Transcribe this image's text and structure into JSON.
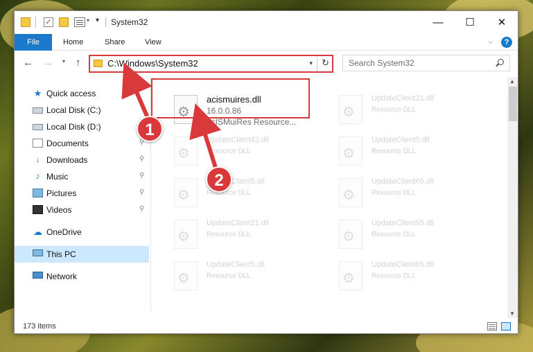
{
  "window": {
    "title": "System32",
    "controls": {
      "minimize": "—",
      "maximize": "☐",
      "close": "✕"
    }
  },
  "ribbon": {
    "tabs": [
      "File",
      "Home",
      "Share",
      "View"
    ],
    "expand_icon": "chevron-down-icon",
    "help_icon": "help-icon",
    "help_glyph": "?"
  },
  "quick_access_toolbar": {
    "icons": [
      "folder-icon",
      "properties-icon",
      "new-folder-icon",
      "view-icon",
      "dropdown-icon"
    ],
    "props_glyph": "✓",
    "drop_glyph": "▾",
    "arrow_glyph": "▾"
  },
  "navigation": {
    "back_glyph": "←",
    "forward_glyph": "→",
    "recent_glyph": "▾",
    "up_glyph": "↑",
    "address": "C:\\Windows\\System32",
    "address_drop_glyph": "▾",
    "refresh_glyph": "↻",
    "search_placeholder": "Search System32"
  },
  "sidebar": {
    "items": [
      {
        "label": "Quick access",
        "icon": "star-icon",
        "glyph": "★",
        "pinned": false
      },
      {
        "label": "Local Disk (C:)",
        "icon": "disk-icon",
        "glyph": "",
        "pinned": false
      },
      {
        "label": "Local Disk (D:)",
        "icon": "disk-icon",
        "glyph": "",
        "pinned": false
      },
      {
        "label": "Documents",
        "icon": "documents-icon",
        "glyph": "",
        "pinned": true
      },
      {
        "label": "Downloads",
        "icon": "downloads-icon",
        "glyph": "↓",
        "pinned": true
      },
      {
        "label": "Music",
        "icon": "music-icon",
        "glyph": "♪",
        "pinned": true
      },
      {
        "label": "Pictures",
        "icon": "pictures-icon",
        "glyph": "",
        "pinned": true
      },
      {
        "label": "Videos",
        "icon": "videos-icon",
        "glyph": "",
        "pinned": true
      },
      {
        "label": "OneDrive",
        "icon": "onedrive-icon",
        "glyph": "☁",
        "pinned": false
      },
      {
        "label": "This PC",
        "icon": "this-pc-icon",
        "glyph": "",
        "pinned": false,
        "selected": true
      },
      {
        "label": "Network",
        "icon": "network-icon",
        "glyph": "",
        "pinned": false
      }
    ],
    "pin_glyph": "📌"
  },
  "files": {
    "highlighted": {
      "name": "acismuires.dll",
      "version": "16.0.0.86",
      "type": "acISMuiRes Resource..."
    },
    "background": [
      {
        "name": "UpdateClient21.dll",
        "type": "Resource DLL"
      },
      {
        "name": "UpdateClient42.dll",
        "type": "Resource DLL"
      },
      {
        "name": "UpdateClient5.dll",
        "type": "Resource DLL"
      },
      {
        "name": "UpdateClient5.dll",
        "type": "Resource DLL"
      },
      {
        "name": "UpdateClient65.dll",
        "type": "Resource DLL"
      },
      {
        "name": "UpdateClient21.dll",
        "type": "Resource DLL"
      },
      {
        "name": "UpdateClient65.dll",
        "type": "Resource DLL"
      },
      {
        "name": "UpdateClient5.dll",
        "type": "Resource DLL"
      },
      {
        "name": "UpdateClient65.dll",
        "type": "Resource DLL"
      }
    ]
  },
  "scrollbar": {
    "up_glyph": "▲",
    "down_glyph": "▼"
  },
  "status": {
    "item_count": "173 items"
  },
  "annotations": {
    "steps": [
      "1",
      "2"
    ],
    "color": "#d9393b"
  }
}
